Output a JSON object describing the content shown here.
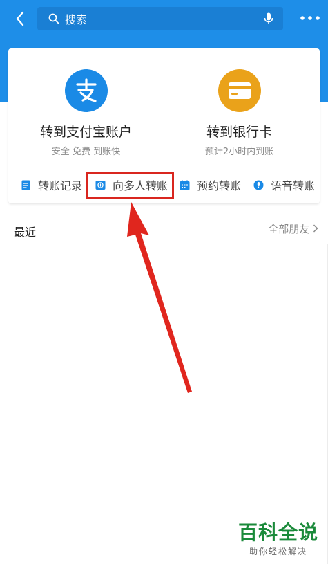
{
  "header": {
    "search_placeholder": "搜索"
  },
  "transfer": {
    "alipay": {
      "title": "转到支付宝账户",
      "subtitle": "安全 免费 到账快"
    },
    "bank": {
      "title": "转到银行卡",
      "subtitle": "预计2小时内到账"
    }
  },
  "quick_actions": [
    {
      "label": "转账记录",
      "icon": "document-icon"
    },
    {
      "label": "向多人转账",
      "icon": "multi-transfer-icon"
    },
    {
      "label": "预约转账",
      "icon": "calendar-icon"
    },
    {
      "label": "语音转账",
      "icon": "microphone-icon"
    }
  ],
  "recent": {
    "title": "最近",
    "all_friends": "全部朋友"
  },
  "watermark": {
    "brand": "百科全说",
    "slogan": "助你轻松解决"
  },
  "colors": {
    "header_blue": "#1e8ee8",
    "alipay_blue": "#1a8ae6",
    "bank_gold": "#eaa21a",
    "highlight_red": "#d9261f",
    "arrow_red": "#e0261e"
  }
}
